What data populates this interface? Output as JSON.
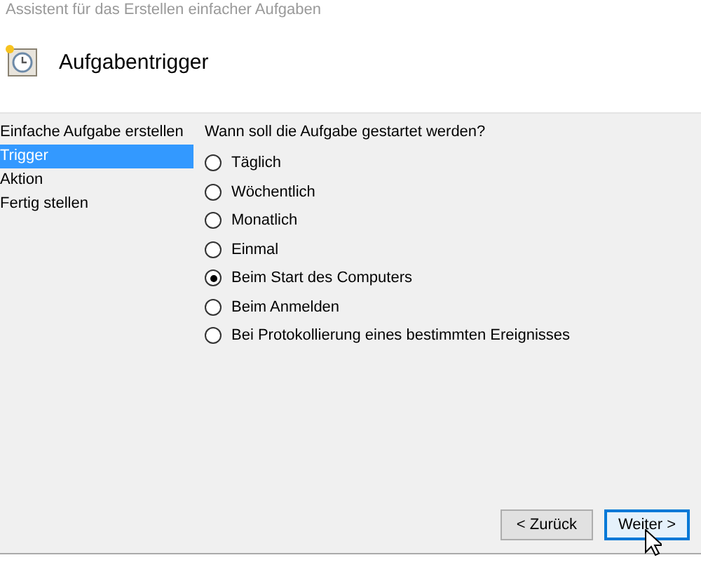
{
  "window": {
    "title": "Assistent für das Erstellen einfacher Aufgaben"
  },
  "header": {
    "title": "Aufgabentrigger"
  },
  "sidebar": {
    "items": [
      {
        "label": "Einfache Aufgabe erstellen",
        "selected": false
      },
      {
        "label": "Trigger",
        "selected": true
      },
      {
        "label": "Aktion",
        "selected": false
      },
      {
        "label": "Fertig stellen",
        "selected": false
      }
    ]
  },
  "question": "Wann soll die Aufgabe gestartet werden?",
  "options": [
    {
      "label": "Täglich",
      "selected": false
    },
    {
      "label": "Wöchentlich",
      "selected": false
    },
    {
      "label": "Monatlich",
      "selected": false
    },
    {
      "label": "Einmal",
      "selected": false
    },
    {
      "label": "Beim Start des Computers",
      "selected": true
    },
    {
      "label": "Beim Anmelden",
      "selected": false
    },
    {
      "label": "Bei Protokollierung eines bestimmten Ereignisses",
      "selected": false
    }
  ],
  "buttons": [
    {
      "label": "< Zurück",
      "default": false
    },
    {
      "label": "Weiter >",
      "default": true
    }
  ]
}
